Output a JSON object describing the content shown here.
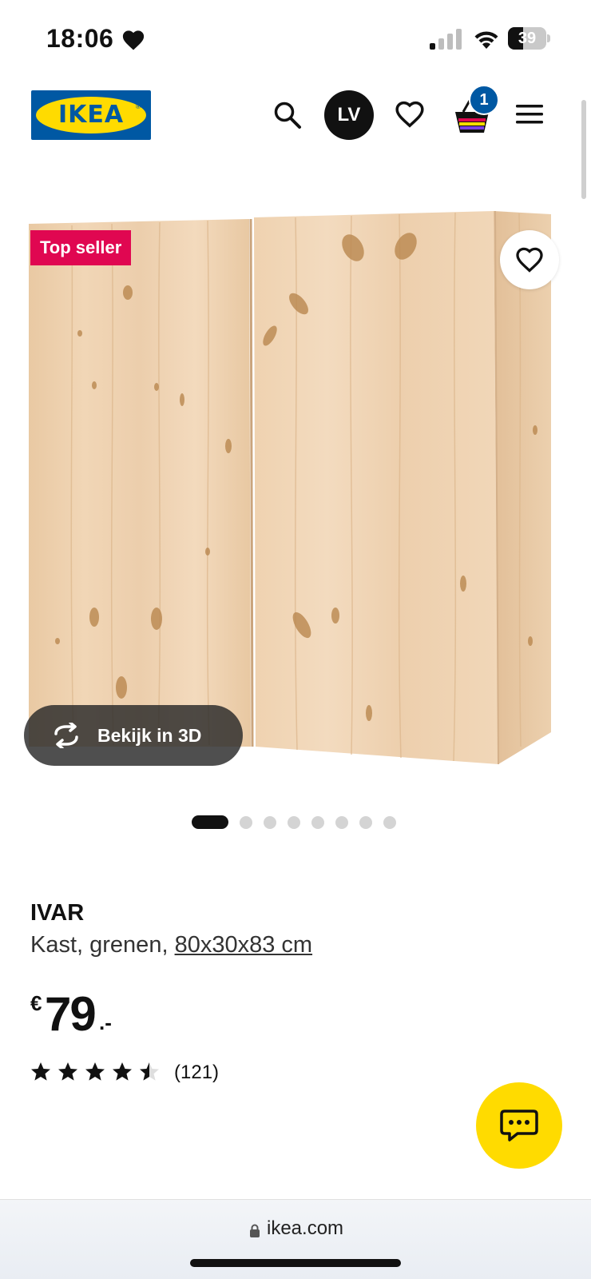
{
  "status_bar": {
    "time": "18:06",
    "battery": "39",
    "battery_level": 0.39
  },
  "header": {
    "logo_text": "IKEA",
    "logo_registered": "®",
    "avatar_initials": "LV",
    "cart_count": "1"
  },
  "product": {
    "badge": "Top seller",
    "view_3d_label": "Bekijk in 3D",
    "carousel_total": 8,
    "carousel_active_index": 0,
    "name": "IVAR",
    "description_prefix": "Kast, grenen, ",
    "size_link": "80x30x83 cm",
    "price_currency": "€",
    "price_integer": "79",
    "price_decimal": ".-",
    "rating": 4.5,
    "rating_max": 5,
    "review_count": "(121)"
  },
  "browser": {
    "url": "ikea.com"
  },
  "colors": {
    "ikea_blue": "#0058a3",
    "ikea_yellow": "#ffdb00",
    "badge_red": "#e00751",
    "text": "#111111"
  },
  "icons": [
    "heart-icon",
    "signal-icon",
    "wifi-icon",
    "battery-icon",
    "search-icon",
    "favorites-heart-icon",
    "shopping-bag-icon",
    "hamburger-menu-icon",
    "rotate-3d-icon",
    "star-icon",
    "chat-icon",
    "lock-icon"
  ]
}
